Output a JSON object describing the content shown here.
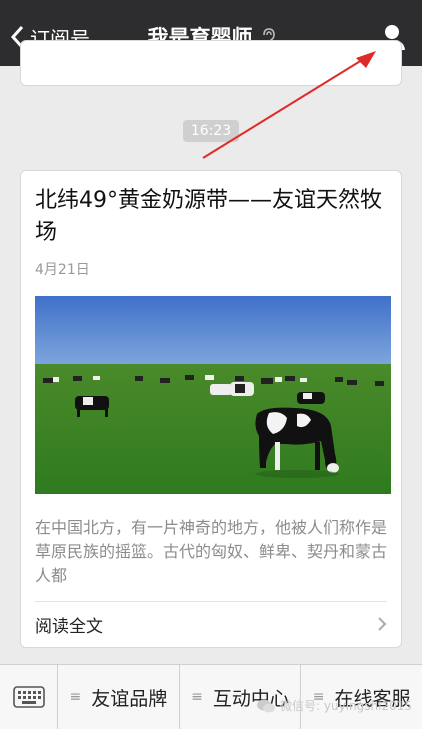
{
  "nav": {
    "back_label": "订阅号",
    "title": "我是育婴师"
  },
  "timestamp": "16:23",
  "article": {
    "title": "北纬49°黄金奶源带——友谊天然牧场",
    "date": "4月21日",
    "excerpt": "在中国北方，有一片神奇的地方，他被人们称作是草原民族的摇篮。古代的匈奴、鲜卑、契丹和蒙古人都",
    "read_more": "阅读全文"
  },
  "menu": {
    "items": [
      {
        "label": "友谊品牌"
      },
      {
        "label": "互动中心"
      },
      {
        "label": "在线客服"
      }
    ]
  },
  "watermark": {
    "text": "微信号: yuyingshi2015"
  },
  "colors": {
    "nav_bg": "#2d2d2f",
    "annotation_arrow": "#e02a2a"
  }
}
